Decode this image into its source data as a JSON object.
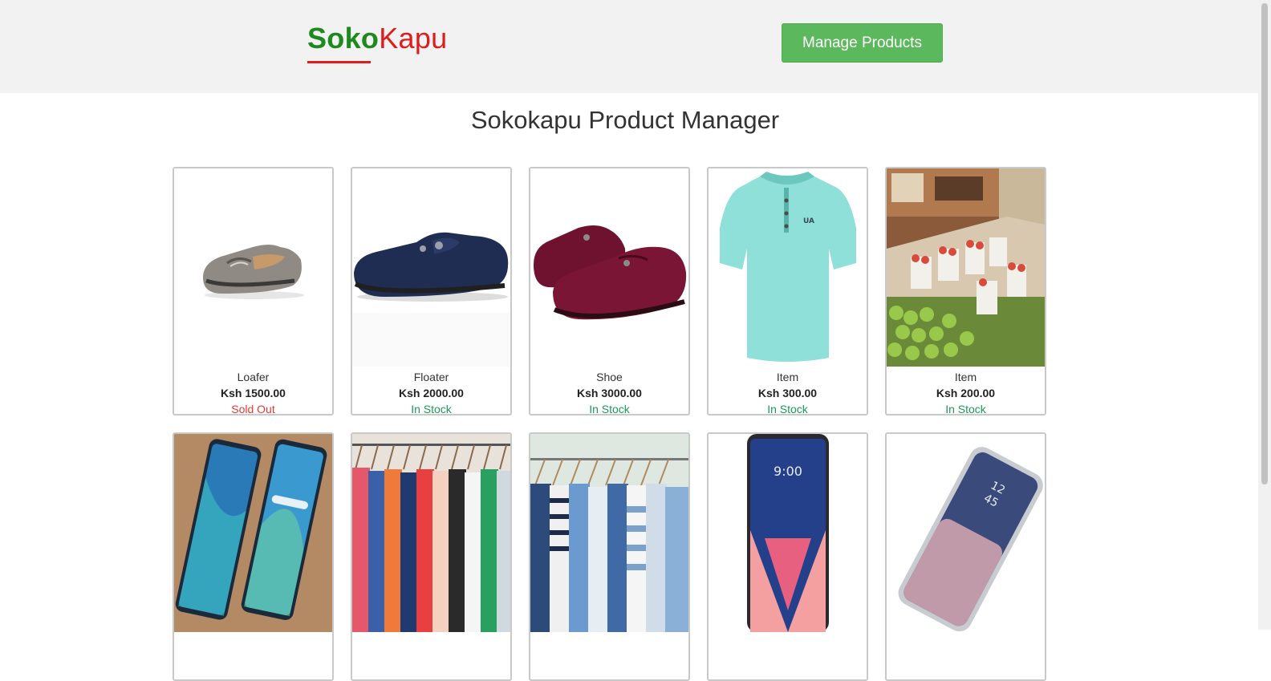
{
  "brand": {
    "part1": "Soko",
    "part2": "Kapu"
  },
  "header": {
    "manage_label": "Manage Products"
  },
  "page_title": "Sokokapu Product Manager",
  "products": [
    {
      "name": "Loafer",
      "price": "Ksh 1500.00",
      "status": "Sold Out",
      "status_key": "sold",
      "image": "grey-loafer-shoe"
    },
    {
      "name": "Floater",
      "price": "Ksh 2000.00",
      "status": "In Stock",
      "status_key": "instock",
      "image": "navy-loafer-shoe"
    },
    {
      "name": "Shoe",
      "price": "Ksh 3000.00",
      "status": "In Stock",
      "status_key": "instock",
      "image": "maroon-loafer-shoes"
    },
    {
      "name": "Item",
      "price": "Ksh 300.00",
      "status": "In Stock",
      "status_key": "instock",
      "image": "mint-polo-shirt"
    },
    {
      "name": "Item",
      "price": "Ksh 200.00",
      "status": "In Stock",
      "status_key": "instock",
      "image": "apples-market"
    },
    {
      "image": "two-smartphones"
    },
    {
      "image": "clothes-rack"
    },
    {
      "image": "shirts-rack"
    },
    {
      "image": "lg-smartphone"
    },
    {
      "image": "samsung-smartphone"
    }
  ],
  "colors": {
    "brand_green": "#1e8a1e",
    "brand_red": "#e01b1b",
    "button_green": "#5cb85c",
    "sold_out": "#e53935",
    "in_stock": "#1a9a55"
  }
}
